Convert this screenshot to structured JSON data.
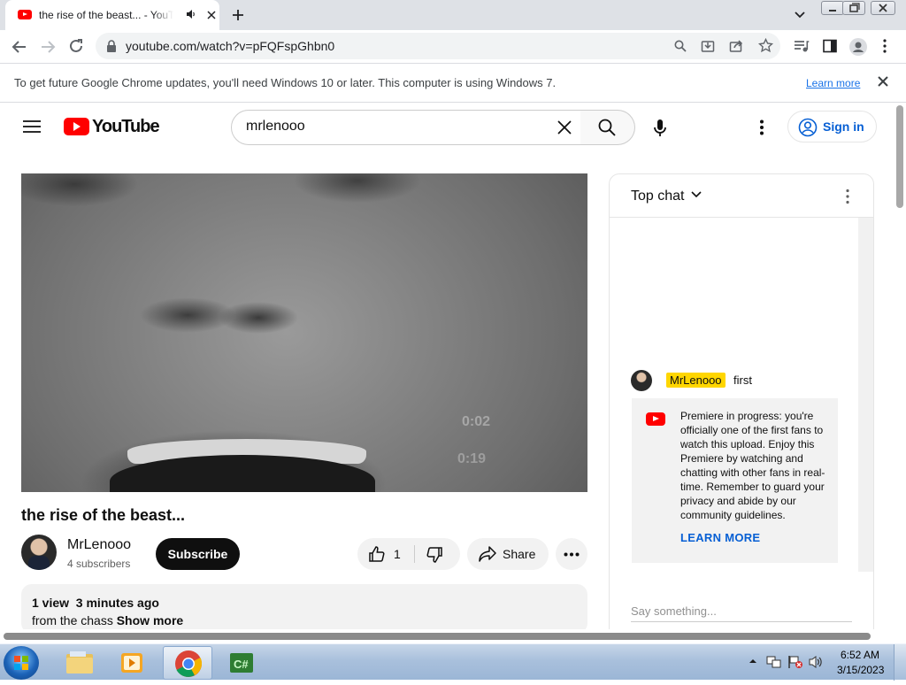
{
  "browser": {
    "tab": {
      "title": "the rise of the beast... - YouTube",
      "favicon": "youtube-icon",
      "audio_icon": "speaker-icon"
    },
    "url": "youtube.com/watch?v=pFQFspGhbn0",
    "infobar": {
      "message": "To get future Google Chrome updates, you'll need Windows 10 or later. This computer is using Windows 7.",
      "link": "Learn more"
    }
  },
  "youtube": {
    "logo_text": "YouTube",
    "search_value": "mrlenooo",
    "sign_in": "Sign in",
    "video": {
      "title": "the rise of the beast...",
      "overlay_text_1": "0:02",
      "overlay_text_2": "0:19"
    },
    "channel": {
      "name": "MrLenooo",
      "subscribers": "4 subscribers"
    },
    "subscribe": "Subscribe",
    "likes": "1",
    "share": "Share",
    "description": {
      "meta": "1 view  3 minutes ago",
      "text": "from the chass",
      "more": "Show more"
    }
  },
  "chat": {
    "title": "Top chat",
    "message": {
      "author": "MrLenooo",
      "text": "first"
    },
    "notice": {
      "text": "Premiere in progress: you're officially one of the first fans to watch this upload. Enjoy this Premiere by watching and chatting with other fans in real-time. Remember to guard your privacy and abide by our community guidelines.",
      "link": "LEARN MORE"
    },
    "input_placeholder": "Say something..."
  },
  "taskbar": {
    "time": "6:52 AM",
    "date": "3/15/2023",
    "apps": [
      "windows-explorer",
      "media-player",
      "google-chrome",
      "csharp-ide"
    ]
  },
  "colors": {
    "youtube_red": "#ff0000",
    "link_blue": "#065fd4",
    "author_highlight": "#ffd600"
  }
}
